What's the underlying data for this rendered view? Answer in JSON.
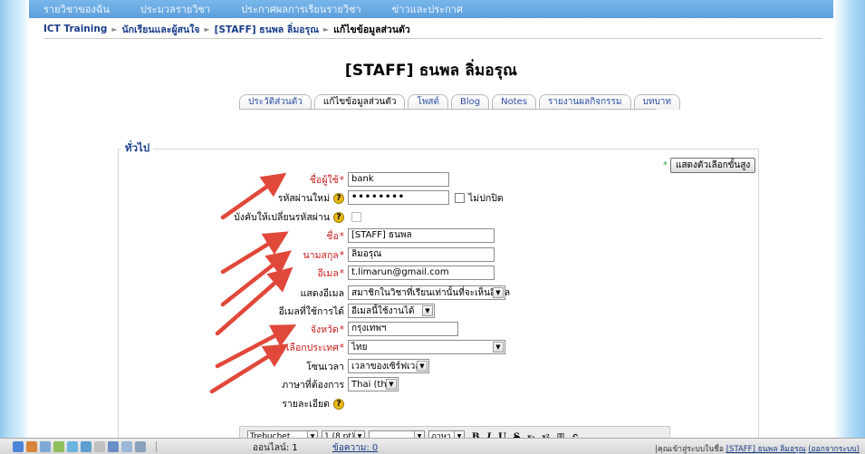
{
  "topnav": {
    "items": [
      "รายวิชาของฉัน",
      "ประมวลรายวิชา",
      "ประกาศผลการเรียนรายวิชา",
      "ข่าวและประกาศ"
    ]
  },
  "breadcrumb": {
    "items": [
      "ICT Training",
      "นักเรียนและผู้สนใจ",
      "[STAFF] ธนพล ลิ่มอรุณ",
      "แก้ไขข้อมูลส่วนตัว"
    ]
  },
  "page_title": "[STAFF] ธนพล ลิ่มอรุณ",
  "tabs": [
    {
      "label": "ประวัติส่วนตัว"
    },
    {
      "label": "แก้ไขข้อมูลส่วนตัว"
    },
    {
      "label": "โพสต์"
    },
    {
      "label": "Blog"
    },
    {
      "label": "Notes"
    },
    {
      "label": "รายงานผลกิจกรรม"
    },
    {
      "label": "บทบาท"
    }
  ],
  "fieldset": {
    "legend": "ทั่วไป",
    "advanced_button": "แสดงตัวเลือกขั้นสูง"
  },
  "form": {
    "username": {
      "label": "ชื่อผู้ใช้",
      "value": "bank"
    },
    "new_password": {
      "label": "รหัสผ่านใหม่",
      "value": "••••••••",
      "unmask_label": "ไม่ปกปิด"
    },
    "force_change": {
      "label": "บังคับให้เปลี่ยนรหัสผ่าน"
    },
    "firstname": {
      "label": "ชื่อ",
      "value": "[STAFF] ธนพล"
    },
    "lastname": {
      "label": "นามสกุล",
      "value": "ลิ่มอรุณ"
    },
    "email": {
      "label": "อีเมล",
      "value": "t.limarun@gmail.com"
    },
    "email_display": {
      "label": "แสดงอีเมล",
      "value": "สมาชิกในวิชาที่เรียนเท่านั้นที่จะเห็นอีเมล"
    },
    "email_enabled": {
      "label": "อีเมลที่ใช้การได้",
      "value": "อีเมลนี้ใช้งานได้"
    },
    "city": {
      "label": "จังหวัด",
      "value": "กรุงเทพฯ"
    },
    "country": {
      "label": "เลือกประเทศ",
      "value": "ไทย"
    },
    "timezone": {
      "label": "โซนเวลา",
      "value": "เวลาของเซิร์ฟเวอร์"
    },
    "language": {
      "label": "ภาษาที่ต้องการ",
      "value": "Thai (th)"
    },
    "description": {
      "label": "รายละเอียด"
    }
  },
  "editor": {
    "font": "Trebuchet",
    "size": "1 (8 pt)",
    "lang": "ภาษา"
  },
  "statusbar": {
    "online_label": "ออนไลน์:",
    "online_count": "1",
    "messages": "ข้อความ: 0",
    "login_prefix": "คุณเข้าสู่ระบบในชื่อ",
    "login_name": "[STAFF] ธนพล ลิ่มอรุณ",
    "logout": "(ออกจากระบบ)"
  },
  "colors": {
    "nav_blue": "#5e9fdc",
    "link": "#1a3d8a",
    "required": "#c81818",
    "annotation_arrow": "#e0483a"
  }
}
